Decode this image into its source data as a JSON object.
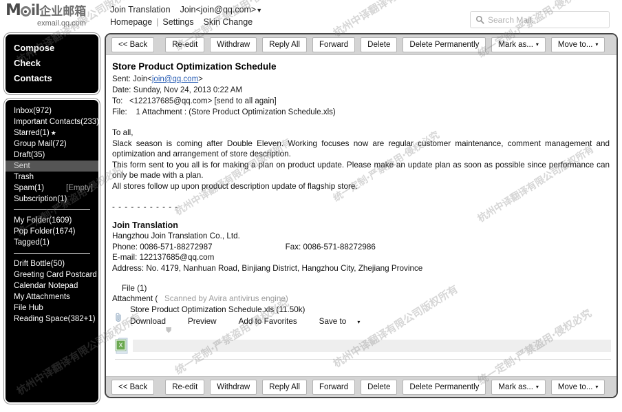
{
  "brand": {
    "logo_main": "M",
    "logo_il": "il",
    "logo_cn": "企业邮箱",
    "logo_sub": "exmail.qq.com"
  },
  "topnav": {
    "org": "Join Translation",
    "account": "Join<join@qq.com>",
    "account_caret": "▼",
    "homepage": "Homepage",
    "sep": "|",
    "settings": "Settings",
    "skin_change": "Skin Change"
  },
  "search": {
    "placeholder": "Search Mail..."
  },
  "sidebar": {
    "top_actions": [
      {
        "label": "Compose"
      },
      {
        "label": "Check"
      },
      {
        "label": "Contacts"
      }
    ],
    "folders": [
      {
        "label": "Inbox(972)",
        "selected": false,
        "right": "",
        "icon": ""
      },
      {
        "label": "Important Contacts(233)",
        "selected": false,
        "right": "",
        "icon": "▐"
      },
      {
        "label": "Starred(1)",
        "selected": false,
        "right": "",
        "icon": "★"
      },
      {
        "label": "Group Mail(72)",
        "selected": false,
        "right": "",
        "icon": ""
      },
      {
        "label": "Draft(35)",
        "selected": false,
        "right": "",
        "icon": ""
      },
      {
        "label": "Sent",
        "selected": true,
        "right": "",
        "icon": ""
      },
      {
        "label": "Trash",
        "selected": false,
        "right": "",
        "icon": ""
      },
      {
        "label": "Spam(1)",
        "selected": false,
        "right": "[Empty]",
        "icon": ""
      },
      {
        "label": "Subscription(1)",
        "selected": false,
        "right": "",
        "icon": ""
      }
    ],
    "folders_group2": [
      {
        "label": "My Folder(1609)"
      },
      {
        "label": "Pop Folder(1674)"
      },
      {
        "label": "Tagged(1)"
      }
    ],
    "tools": [
      {
        "label": "Drift Bottle(50)"
      },
      {
        "label": "Greeting Card Postcard"
      },
      {
        "label": "Calendar        Notepad"
      },
      {
        "label": "My Attachments"
      },
      {
        "label": "File Hub"
      },
      {
        "label": "Reading Space(382+1)"
      }
    ]
  },
  "toolbar": {
    "back": "<< Back",
    "buttons": [
      {
        "label": "Re-edit",
        "caret": false
      },
      {
        "label": "Withdraw",
        "caret": false
      },
      {
        "label": "Reply All",
        "caret": false
      },
      {
        "label": "Forward",
        "caret": false
      },
      {
        "label": "Delete",
        "caret": false
      },
      {
        "label": "Delete Permanently",
        "caret": false
      },
      {
        "label": "Mark as...",
        "caret": true
      },
      {
        "label": "Move to...",
        "caret": true
      }
    ],
    "caret_glyph": "▾"
  },
  "mail": {
    "subject": "Store Product Optimization Schedule",
    "sent_label": "Sent:",
    "sent_prefix": "Join<",
    "sent_email": "join@qq.com",
    "sent_suffix": ">",
    "date_label": "Date:",
    "date_value": "Sunday, Nov 24, 2013 0:22 AM",
    "to_label": "To:",
    "to_value": "<122137685@qq.com> [send to all again]",
    "file_label": "File:",
    "file_value": "1 Attachment : (Store Product Optimization Schedule.xls)",
    "body": {
      "greeting": "To all,",
      "para1": "Slack season is coming after Double Eleven. Working focuses now are regular customer maintenance, comment management and optimization and arrangement of store description.",
      "para2": "This form sent to you all is for making a plan on product update. Please make an update plan as soon as possible since performance can only be made with a plan.",
      "para3": "All stores follow up upon product description update of flagship store."
    },
    "signature": {
      "dashes": "- - - - - - - - - - -",
      "name": "Join Translation",
      "company": "Hangzhou Join Translation Co., Ltd.",
      "phone": "Phone: 0086-571-88272987",
      "fax": "Fax: 0086-571-88272986",
      "email": "E-mail: 122137685@qq.com",
      "address": "Address: No. 4179, Nanhuan Road, Binjiang District, Hangzhou City, Zhejiang Province"
    }
  },
  "attachment": {
    "file_count": "File (1)",
    "heading": "Attachment (",
    "scan_text": "Scanned by Avira antivirus engine)",
    "name": "Store Product Optimization Schedule.xls (11.50k)",
    "actions": [
      {
        "label": "Download",
        "caret": false
      },
      {
        "label": "Preview",
        "caret": false
      },
      {
        "label": "Add to Favorites",
        "caret": false
      },
      {
        "label": "Save to",
        "caret": true
      }
    ],
    "caret_glyph": "▾"
  },
  "watermark": {
    "line1": "杭州中译翻译有限公司版权所有",
    "line2": "统一定制·严禁盗用·侵权必究"
  },
  "colors": {
    "sidebar_bg": "#000000",
    "sidebar_selected": "#555555",
    "toolbar_bg": "#d4d4d4",
    "link": "#2b5fb5",
    "panel_border": "#454545"
  }
}
